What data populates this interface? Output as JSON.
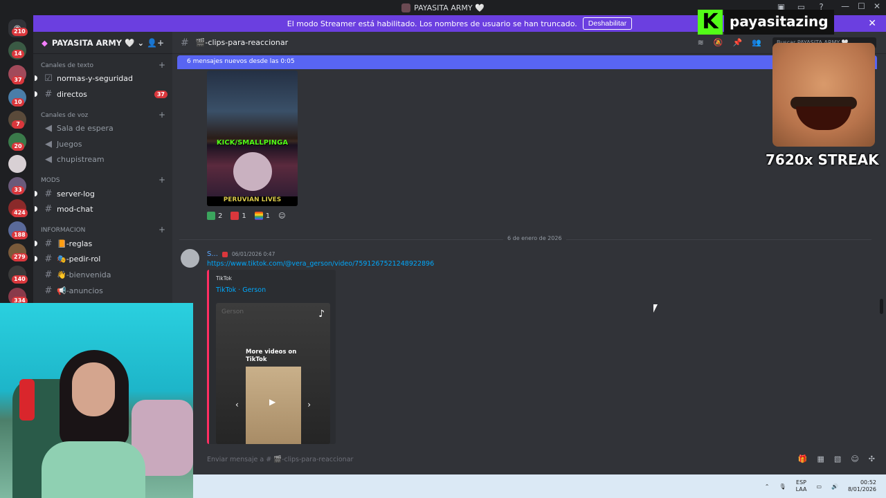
{
  "window": {
    "title": "PAYASITA ARMY 🤍",
    "controls": [
      "—",
      "☐",
      "✕"
    ]
  },
  "banner": {
    "text": "El modo Streamer está habilitado. Los nombres de usuario se han truncado.",
    "button": "Deshabilitar"
  },
  "guilds": {
    "badges": [
      "210",
      "14",
      "37",
      "10",
      "7",
      "20",
      "33",
      "424",
      "188",
      "279",
      "140",
      "334"
    ]
  },
  "server": {
    "name": "PAYASITA ARMY 🤍"
  },
  "sidebar": {
    "categories": {
      "text": "Canales de texto",
      "voice": "Canales de voz",
      "mods": "MODS",
      "info": "INFORMACION"
    },
    "channels": [
      {
        "label": "normas-y-seguridad"
      },
      {
        "label": "directos",
        "mention": "37"
      },
      {
        "label": "Sala de espera"
      },
      {
        "label": "Juegos"
      },
      {
        "label": "chupistream"
      },
      {
        "label": "server-log"
      },
      {
        "label": "mod-chat"
      },
      {
        "label": "📙-reglas"
      },
      {
        "label": "🎭-pedir-rol"
      },
      {
        "label": "👋-bienvenida"
      },
      {
        "label": "📢-anuncios"
      }
    ]
  },
  "channel": {
    "name": "🎬-clips-para-reaccionar",
    "search_placeholder": "Buscar PAYASITA ARMY 🤍",
    "new_messages": "6 mensajes nuevos desde las 0:05"
  },
  "message1": {
    "image_caption": "KICK/SMALLPINGA",
    "image_footer": "PERUVIAN LIVES",
    "reactions": [
      {
        "emoji": "check",
        "count": "2",
        "color": "#3ba55d"
      },
      {
        "emoji": "cross",
        "count": "1",
        "color": "#da373c"
      },
      {
        "emoji": "rainbow-flag",
        "count": "1",
        "color": "#e0a030"
      }
    ]
  },
  "divider": {
    "date": "6 de enero de 2026"
  },
  "message2": {
    "author": "S...",
    "timestamp": "06/01/2026 0:47",
    "link": "https://www.tiktok.com/@vera_gerson/video/7591267521248922896",
    "embed": {
      "provider": "TikTok",
      "title": "TikTok · Gerson",
      "ghost_name": "Gerson",
      "more_videos": "More videos on TikTok"
    }
  },
  "composer": {
    "placeholder": "Enviar mensaje a # 🎬-clips-para-reaccionar"
  },
  "overlay": {
    "name": "payasitazing",
    "streak": "7620x STREAK"
  },
  "taskbar": {
    "lang1": "ESP",
    "lang2": "LAA",
    "time": "00:52",
    "date": "8/01/2026"
  }
}
